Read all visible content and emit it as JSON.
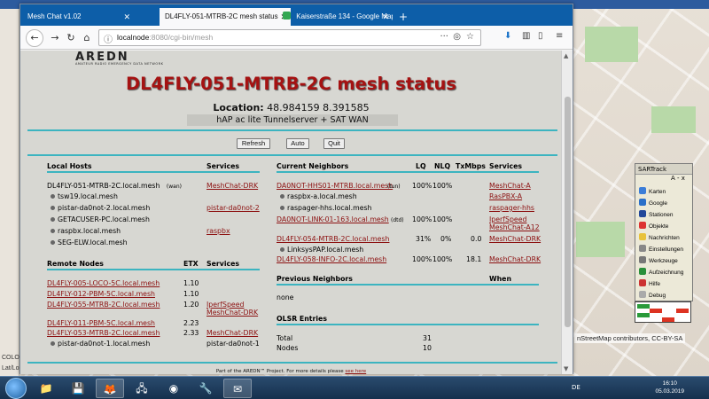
{
  "desktop": {
    "map_attribution": "nStreetMap contributors, CC-BY-SA",
    "left_strip": [
      "Lat/Lo",
      "COLO"
    ]
  },
  "browser": {
    "tabs": [
      {
        "label": "Mesh Chat v1.02",
        "active": false
      },
      {
        "label": "DL4FLY-051-MTRB-2C mesh status",
        "active": true
      },
      {
        "label": "Kaiserstraße 134 - Google Maps",
        "active": false
      }
    ],
    "url_host": "localnode",
    "url_rest": ":8080/cgi-bin/mesh"
  },
  "page": {
    "logo": "AREDN",
    "logo_sub": "AMATEUR RADIO EMERGENCY DATA NETWORK",
    "title": "DL4FLY-051-MTRB-2C mesh status",
    "location_label": "Location:",
    "location_value": "48.984159 8.391585",
    "device": "hAP ac lite Tunnelserver + SAT WAN",
    "buttons": {
      "refresh": "Refresh",
      "auto": "Auto",
      "quit": "Quit"
    },
    "local_hosts": {
      "header": "Local Hosts",
      "services_header": "Services",
      "rows": [
        {
          "name": "DL4FLY-051-MTRB-2C.local.mesh",
          "tag": "(wan)",
          "service": "MeshChat-DRK",
          "dot": false
        },
        {
          "name": "tsw19.local.mesh",
          "tag": "",
          "service": "",
          "dot": true
        },
        {
          "name": "pistar-da0not-2.local.mesh",
          "tag": "",
          "service": "pistar-da0not-2",
          "dot": true
        },
        {
          "name": "GETACUSER-PC.local.mesh",
          "tag": "",
          "service": "",
          "dot": true
        },
        {
          "name": "raspbx.local.mesh",
          "tag": "",
          "service": "raspbx",
          "dot": true
        },
        {
          "name": "SEG-ELW.local.mesh",
          "tag": "",
          "service": "",
          "dot": true
        }
      ]
    },
    "remote_nodes": {
      "header": "Remote Nodes",
      "etx_header": "ETX",
      "services_header": "Services",
      "rows": [
        {
          "name": "DL4FLY-005-LOCO-5C.local.mesh",
          "etx": "1.10",
          "services": []
        },
        {
          "name": "DL4FLY-012-PBM-5C.local.mesh",
          "etx": "1.10",
          "services": []
        },
        {
          "name": "DL4FLY-055-MTRB-2C.local.mesh",
          "etx": "1.20",
          "services": [
            "IperfSpeed",
            "MeshChat-DRK"
          ]
        },
        {
          "name": "DL4FLY-011-PBM-5C.local.mesh",
          "etx": "2.23",
          "services": []
        },
        {
          "name": "DL4FLY-053-MTRB-2C.local.mesh",
          "etx": "2.33",
          "services": [
            "MeshChat-DRK"
          ]
        },
        {
          "name": "pistar-da0not-1.local.mesh",
          "etx": "",
          "services": [
            "pistar-da0not-1"
          ],
          "dot": true
        }
      ]
    },
    "current_neighbors": {
      "header": "Current Neighbors",
      "lq_header": "LQ",
      "nlq_header": "NLQ",
      "txmbps_header": "TxMbps",
      "services_header": "Services",
      "rows": [
        {
          "name": "DA0NOT-HHS01-MTRB.local.mesh",
          "tag": "(tun)",
          "lq": "100%",
          "nlq": "100%",
          "tx": "",
          "services": [
            "MeshChat-A"
          ]
        },
        {
          "name": "raspbx-a.local.mesh",
          "dot": true,
          "services": [
            "RasPBX-A"
          ]
        },
        {
          "name": "raspager-hhs.local.mesh",
          "dot": true,
          "services": [
            "raspager-hhs"
          ]
        },
        {
          "name": "DA0NOT-LINK-01-163.local.mesh",
          "tag": "(dtd)",
          "lq": "100%",
          "nlq": "100%",
          "tx": "",
          "services": [
            "IperfSpeed",
            "MeshChat-A12"
          ]
        },
        {
          "name": "DL4FLY-054-MTRB-2C.local.mesh",
          "lq": "31%",
          "nlq": "0%",
          "tx": "0.0",
          "services": [
            "MeshChat-DRK"
          ]
        },
        {
          "name": "LinksysPAP.local.mesh",
          "dot": true,
          "services": []
        },
        {
          "name": "DL4FLY-058-INFO-2C.local.mesh",
          "lq": "100%",
          "nlq": "100%",
          "tx": "18.1",
          "services": [
            "MeshChat-DRK"
          ]
        }
      ]
    },
    "previous_neighbors": {
      "header": "Previous Neighbors",
      "when_header": "When",
      "none": "none"
    },
    "olsr": {
      "header": "OLSR Entries",
      "total_label": "Total",
      "total": "31",
      "nodes_label": "Nodes",
      "nodes": "10"
    },
    "footer_prefix": "Part of the AREDN™ Project. For more details please",
    "footer_link": "see here"
  },
  "sartrack": {
    "title": "SARTrack",
    "items": [
      "Karten",
      "Google",
      "Stationen",
      "Objekte",
      "Nachrichten",
      "Einstellungen",
      "Werkzeuge",
      "Aufzeichnung",
      "Hilfe",
      "Debug"
    ]
  },
  "taskbar": {
    "lang": "DE",
    "time": "16:10",
    "date": "05.03.2019"
  }
}
